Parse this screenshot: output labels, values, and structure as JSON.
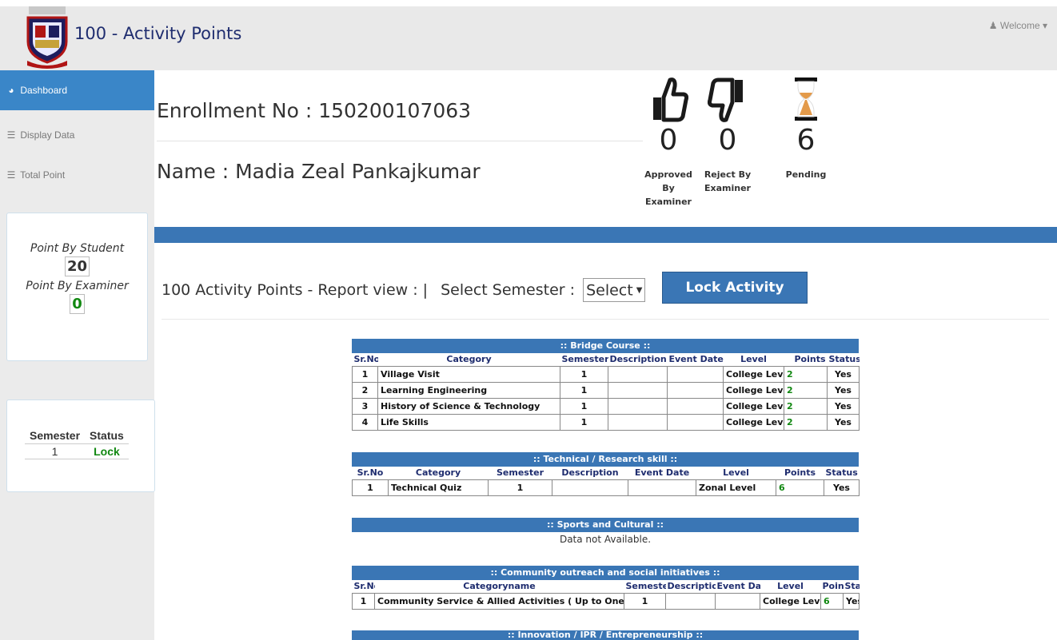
{
  "header": {
    "brand": "100 - Activity Points",
    "welcome": "Welcome",
    "logo_icon": "university-crest-icon",
    "user_icon": "user-icon",
    "caret_icon": "caret-down-icon"
  },
  "sidebar": {
    "items": [
      {
        "label": "Dashboard",
        "icon": "dashboard-icon",
        "active": true
      },
      {
        "label": "Display Data",
        "icon": "list-icon",
        "active": false
      },
      {
        "label": "Total Point",
        "icon": "list-icon",
        "active": false
      }
    ],
    "points": {
      "student_label": "Point By Student",
      "student_value": "20",
      "examiner_label": "Point By Examiner",
      "examiner_value": "0"
    },
    "semester_status": {
      "headers": [
        "Semester",
        "Status"
      ],
      "rows": [
        [
          "1",
          "Lock"
        ]
      ]
    }
  },
  "profile": {
    "enrollment": "Enrollment No : 150200107063",
    "name": "Name : Madia Zeal Pankajkumar"
  },
  "stats": [
    {
      "icon": "thumbs-up-icon",
      "value": "0",
      "caption": "Approved By Examiner"
    },
    {
      "icon": "thumbs-down-icon",
      "value": "0",
      "caption": "Reject By Examiner"
    },
    {
      "icon": "hourglass-icon",
      "value": "6",
      "caption": "Pending"
    }
  ],
  "report": {
    "label": "100 Activity Points - Report view : |",
    "select_label": "Select Semester :",
    "select_value": "Select",
    "lock_button": "Lock Activity"
  },
  "tables": {
    "bridge": {
      "title": ":: Bridge Course ::",
      "headers": [
        "Sr.No",
        "Category",
        "Semester",
        "Description",
        "Event Date",
        "Level",
        "Points",
        "Status"
      ],
      "rows": [
        [
          "1",
          "Village Visit",
          "1",
          "",
          "",
          "College Level",
          "2",
          "Yes"
        ],
        [
          "2",
          "Learning Engineering",
          "1",
          "",
          "",
          "College Level",
          "2",
          "Yes"
        ],
        [
          "3",
          "History of Science & Technology",
          "1",
          "",
          "",
          "College Level",
          "2",
          "Yes"
        ],
        [
          "4",
          "Life Skills",
          "1",
          "",
          "",
          "College Level",
          "2",
          "Yes"
        ]
      ]
    },
    "technical": {
      "title": ":: Technical / Research skill ::",
      "headers": [
        "Sr.No",
        "Category",
        "Semester",
        "Description",
        "Event Date",
        "Level",
        "Points",
        "Status"
      ],
      "rows": [
        [
          "1",
          "Technical Quiz",
          "1",
          "",
          "",
          "Zonal Level",
          "6",
          "Yes"
        ]
      ]
    },
    "sports": {
      "title": ":: Sports and Cultural ::",
      "empty": "Data not Available."
    },
    "community": {
      "title": ":: Community outreach and social initiatives ::",
      "headers": [
        "Sr.No",
        "Categoryname",
        "Semester",
        "Description",
        "Event Date",
        "Level",
        "Points",
        "Status"
      ],
      "rows": [
        [
          "1",
          "Community Service & Allied Activities ( Up to One Week )",
          "1",
          "",
          "",
          "College Level",
          "6",
          "Yes"
        ]
      ]
    },
    "innovation": {
      "title": ":: Innovation / IPR / Entrepreneurship ::"
    }
  },
  "colors": {
    "primary": "#3a76b5",
    "sidebar_active": "#3a86c8",
    "success": "#118811",
    "brand_text": "#1f2d6f"
  }
}
